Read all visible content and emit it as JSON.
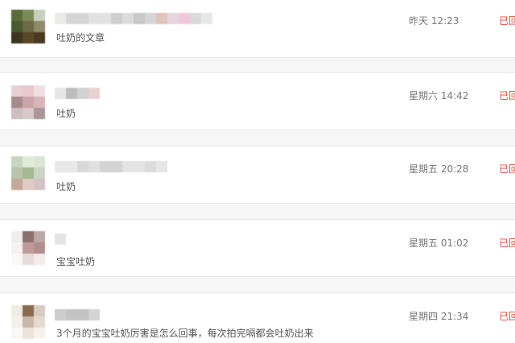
{
  "messages": [
    {
      "text": "吐奶的文章",
      "time": "昨天 12:23",
      "status": "已回"
    },
    {
      "text": "吐奶",
      "time": "星期六 14:42",
      "status": "已回"
    },
    {
      "text": "吐奶",
      "time": "星期五 20:28",
      "status": "已回"
    },
    {
      "text": "宝宝吐奶",
      "time": "星期五 01:02",
      "status": "已回"
    },
    {
      "text": "3个月的宝宝吐奶厉害是怎么回事，每次拍完嗝都会吐奶出来",
      "time": "星期四 21:34",
      "status": "已回"
    }
  ],
  "colors": {
    "status": "#e64a3b",
    "time": "#777777",
    "message": "#555555",
    "divider": "#e8e8e8",
    "gap": "#f6f6f6"
  }
}
